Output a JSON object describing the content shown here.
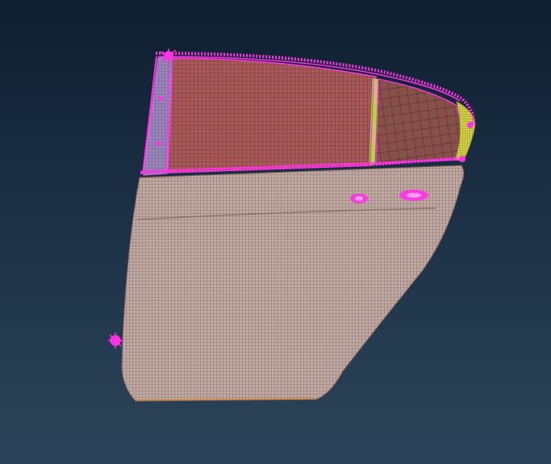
{
  "viewport": {
    "background_top": "#0f1e30",
    "background_bottom": "#2c4459"
  },
  "model": {
    "part": "rear-door-mesh",
    "components": [
      {
        "id": "outer-panel",
        "color": "#b6a19a",
        "line_color": "#6f5454"
      },
      {
        "id": "window-glass",
        "color": "#a85a5a",
        "line_color": "#5a1f24"
      },
      {
        "id": "rear-quarter-glass",
        "color": "#87504a",
        "line_color": "#3d1e1c"
      },
      {
        "id": "front-frame-strip",
        "color": "#9a86b8",
        "line_color": "#5b4a7a"
      },
      {
        "id": "division-bar",
        "color": "#b9d14a",
        "line_color": "#4d6a1a"
      },
      {
        "id": "corner-trim",
        "color": "#d7d34a",
        "line_color": "#6d6a12"
      },
      {
        "id": "rigid-connectors",
        "color": "#ff33e6"
      }
    ]
  }
}
